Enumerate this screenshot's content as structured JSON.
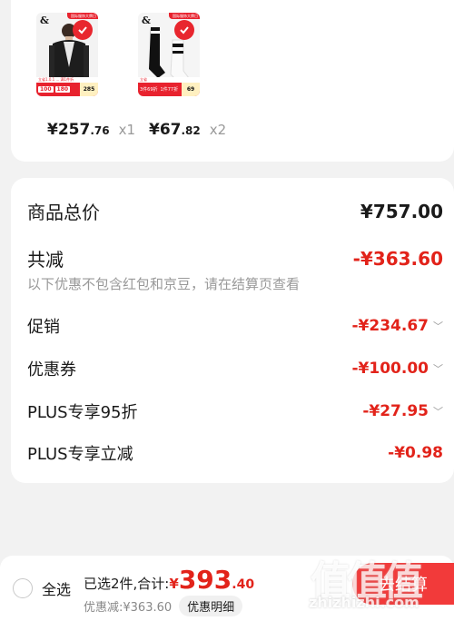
{
  "products": [
    {
      "brand": "&",
      "ribbon_text": "国际服饰大牌日",
      "tagline": "立省1.0.1 ... 满1件折",
      "bar_pill_1": "100",
      "bar_pill_2": "180",
      "bar_final": "285",
      "price_int": "¥257",
      "price_dec": ".76",
      "qty": "x1"
    },
    {
      "brand": "&",
      "ribbon_text": "国际服饰大牌日",
      "tagline": "立省",
      "bar_text_1": "3件69折",
      "bar_text_2": "1件77折",
      "bar_final": "69",
      "price_int": "¥67",
      "price_dec": ".82",
      "qty": "x2"
    }
  ],
  "summary": {
    "total_label": "商品总价",
    "total_value": "¥757.00",
    "discount_label": "共减",
    "discount_value": "-¥363.60",
    "note": "以下优惠不包含红包和京豆，请在结算页查看",
    "items": [
      {
        "label": "促销",
        "value": "-¥234.67",
        "chevron": "﹀"
      },
      {
        "label": "优惠券",
        "value": "-¥100.00",
        "chevron": "﹀"
      },
      {
        "label": "PLUS专享95折",
        "value": "-¥27.95",
        "chevron": "﹀"
      },
      {
        "label": "PLUS专享立减",
        "value": "-¥0.98",
        "chevron": ""
      }
    ]
  },
  "bottom": {
    "select_all": "全选",
    "selected_prefix": "已选2件,合计:",
    "amount_currency": "¥",
    "amount_int": "393",
    "amount_dec": ".40",
    "saved": "优惠减:¥363.60",
    "detail_button": "优惠明细",
    "checkout_button": "去结算"
  },
  "watermark": {
    "chars": "值值值",
    "url": "zhizhizhi.com"
  },
  "colors": {
    "accent": "#e2231a",
    "checkout": "#f23a3a",
    "background": "#f2f2f2"
  }
}
